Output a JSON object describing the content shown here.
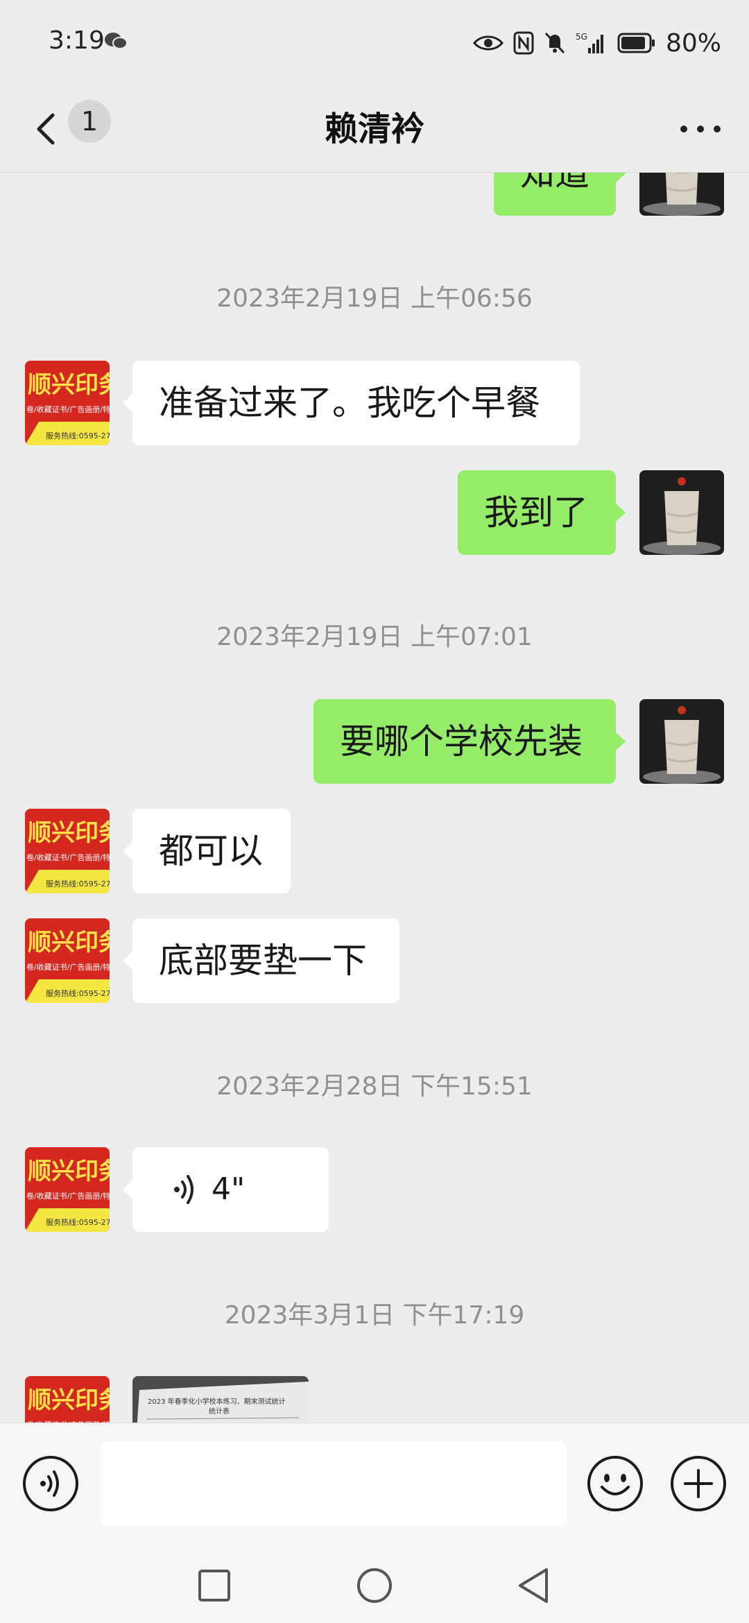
{
  "status_bar": {
    "time": "3:19",
    "battery": "80%"
  },
  "header": {
    "unread_count": "1",
    "title": "赖清衿"
  },
  "messages": [
    {
      "text": "知道"
    },
    {
      "timestamp": "2023年2月19日 上午06:56"
    },
    {
      "text": "准备过来了。我吃个早餐"
    },
    {
      "text": "我到了"
    },
    {
      "timestamp": "2023年2月19日 上午07:01"
    },
    {
      "text": "要哪个学校先装"
    },
    {
      "text": "都可以"
    },
    {
      "text": "底部要垫一下"
    },
    {
      "timestamp": "2023年2月28日 下午15:51"
    },
    {
      "voice_duration": "4\""
    },
    {
      "timestamp": "2023年3月1日 下午17:19"
    }
  ],
  "contact_avatar": {
    "line1": "顺兴印务",
    "line2": "卷/收藏证书/广告画册/特",
    "line3": "服务热线:0595-27"
  },
  "photo_preview": {
    "line1": "2023 年春季化小学校本练习、期末测试统计",
    "line2": "统计表"
  },
  "colors": {
    "sent_bubble": "#95ec69",
    "received_bubble": "#ffffff",
    "background": "#ededed"
  },
  "icons": [
    "back-icon",
    "more-icon",
    "voice-icon",
    "emoji-icon",
    "plus-icon",
    "square-nav-icon",
    "circle-nav-icon",
    "triangle-nav-icon"
  ]
}
